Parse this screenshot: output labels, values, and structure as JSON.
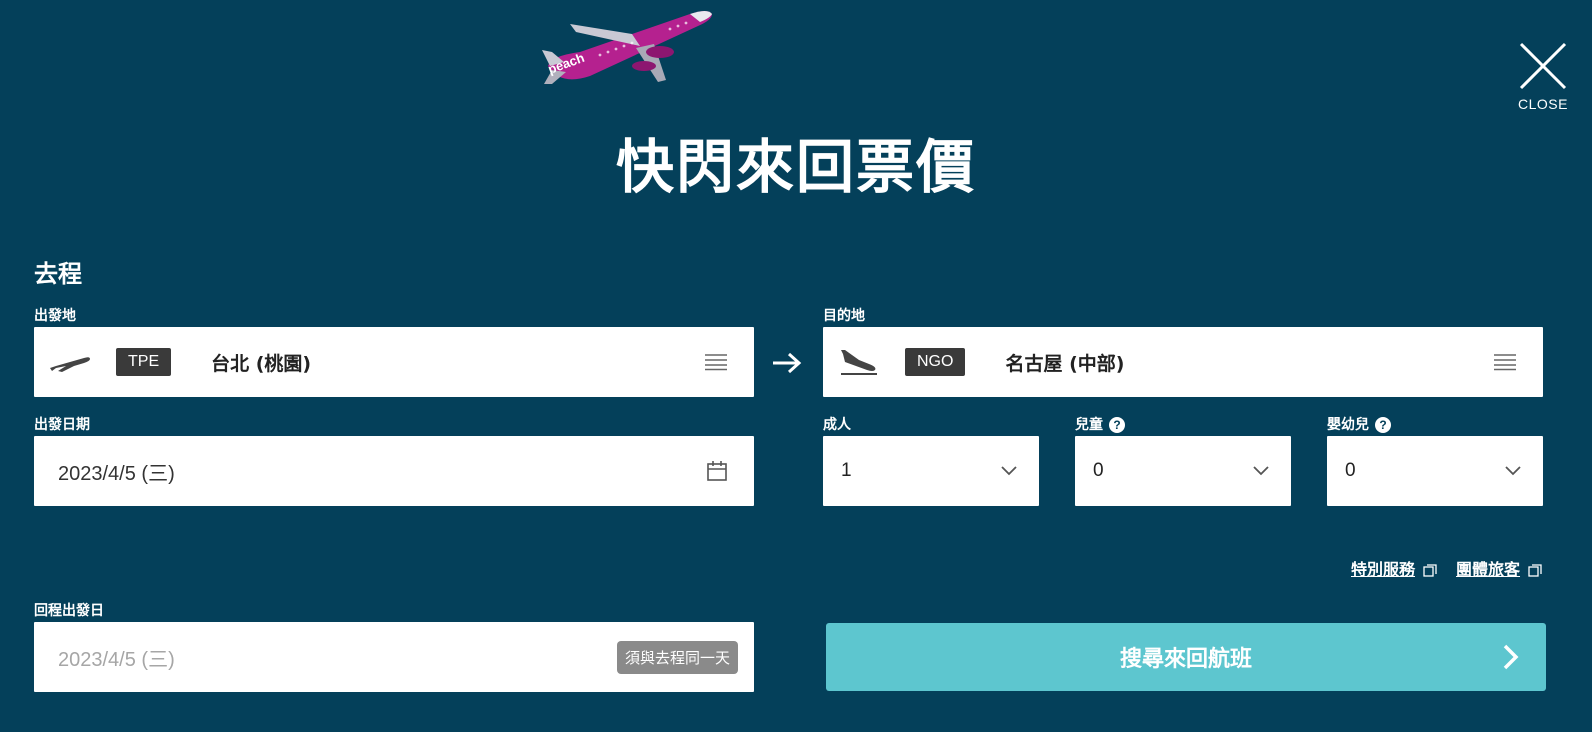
{
  "header": {
    "title": "快閃來回票價",
    "close_label": "CLOSE",
    "plane_logo_text": "peach"
  },
  "outbound": {
    "section_title": "去程",
    "origin": {
      "label": "出發地",
      "code": "TPE",
      "city": "台北 (桃園)"
    },
    "destination": {
      "label": "目的地",
      "code": "NGO",
      "city": "名古屋 (中部)"
    },
    "departure_date": {
      "label": "出發日期",
      "value": "2023/4/5 (三)"
    }
  },
  "passengers": {
    "adult": {
      "label": "成人",
      "value": "1"
    },
    "child": {
      "label": "兒童",
      "value": "0"
    },
    "infant": {
      "label": "嬰幼兒",
      "value": "0"
    }
  },
  "links": {
    "special_service": "特別服務",
    "group_travel": "團體旅客"
  },
  "return": {
    "label": "回程出發日",
    "value": "2023/4/5 (三)",
    "note": "須與去程同一天"
  },
  "search_button": {
    "label": "搜尋來回航班"
  },
  "colors": {
    "background": "#04405a",
    "accent": "#5dc6cf",
    "plane_brand": "#b5218f"
  },
  "icons": {
    "departure": "takeoff-icon",
    "arrival": "landing-icon",
    "menu": "menu-lines-icon",
    "calendar": "calendar-icon",
    "chevron": "chevron-down-icon"
  }
}
